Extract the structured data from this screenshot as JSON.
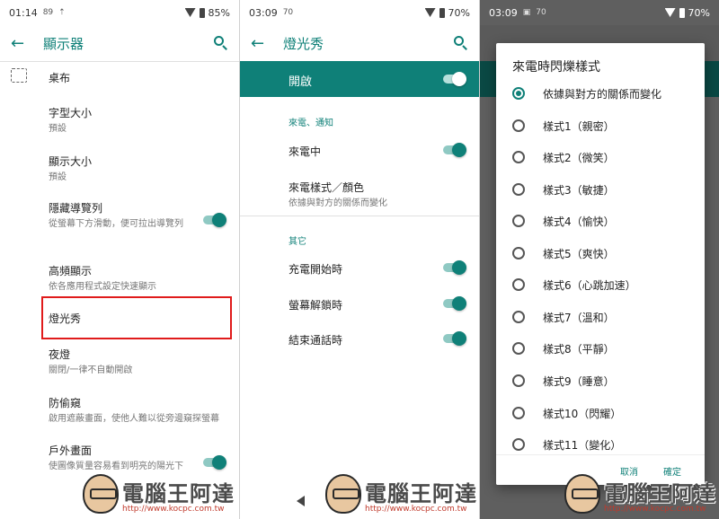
{
  "panel1": {
    "status": {
      "time": "01:14",
      "icons": [
        "89",
        "⇡"
      ],
      "battery": "85%"
    },
    "title": "顯示器",
    "items": [
      {
        "title": "桌布"
      },
      {
        "title": "字型大小",
        "subtitle": "預設"
      },
      {
        "title": "顯示大小",
        "subtitle": "預設"
      },
      {
        "title": "隱藏導覽列",
        "subtitle": "從螢幕下方滑動，便可拉出導覽列"
      },
      {
        "title": "高頻顯示",
        "subtitle": "依各應用程式設定快速顯示"
      },
      {
        "title": "燈光秀"
      },
      {
        "title": "夜燈",
        "subtitle": "關閉/一律不自動開啟"
      },
      {
        "title": "防偷窺",
        "subtitle": "啟用遮蔽畫面，使他人難以從旁邊窺探螢幕"
      },
      {
        "title": "戶外畫面",
        "subtitle": "使圖像質量容易看到明亮的陽光下"
      }
    ]
  },
  "panel2": {
    "status": {
      "time": "03:09",
      "icons": [
        "70"
      ],
      "battery": "70%"
    },
    "title": "燈光秀",
    "master_label": "開啟",
    "section1": "來電、通知",
    "incoming_call": "來電中",
    "call_style_title": "來電樣式／顏色",
    "call_style_subtitle": "依據與對方的關係而變化",
    "section2": "其它",
    "charging": "充電開始時",
    "unlock": "螢幕解鎖時",
    "call_end": "結束通話時"
  },
  "panel3": {
    "status": {
      "time": "03:09",
      "icons": [
        "▣",
        "70"
      ],
      "battery": "70%"
    },
    "dialog_title": "來電時閃爍樣式",
    "options": [
      "依據與對方的關係而變化",
      "樣式1（親密）",
      "樣式2（微笑）",
      "樣式3（敏捷）",
      "樣式4（愉快）",
      "樣式5（爽快）",
      "樣式6（心跳加速）",
      "樣式7（溫和）",
      "樣式8（平靜）",
      "樣式9（睡意）",
      "樣式10（閃耀）",
      "樣式11（變化）"
    ],
    "selected_index": 0,
    "cancel": "取消",
    "ok": "確定"
  },
  "watermark": {
    "text": "電腦王阿達",
    "url": "http://www.kocpc.com.tw"
  },
  "colors": {
    "accent": "#0f8078",
    "highlight": "#e01b1b"
  }
}
